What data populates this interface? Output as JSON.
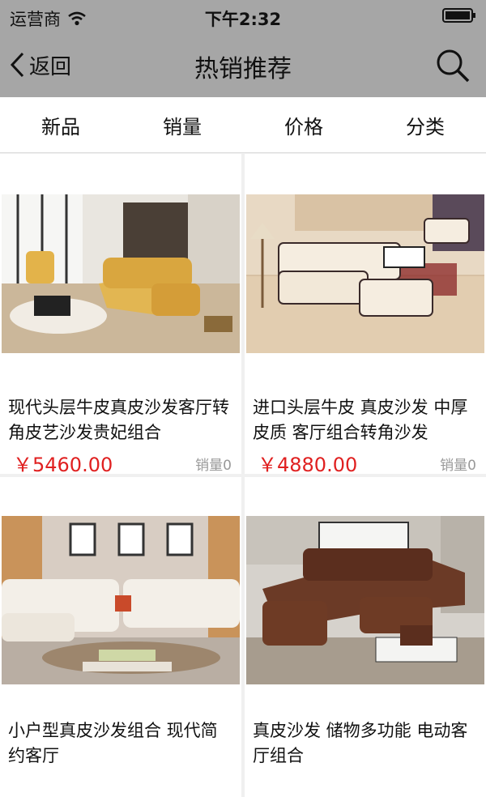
{
  "status": {
    "carrier": "运营商",
    "time": "下午2:32"
  },
  "nav": {
    "back_label": "返回",
    "title": "热销推荐"
  },
  "tabs": [
    "新品",
    "销量",
    "价格",
    "分类"
  ],
  "products": [
    {
      "title": "现代头层牛皮真皮沙发客厅转角皮艺沙发贵妃组合",
      "price": "￥5460.00",
      "sales": "销量0"
    },
    {
      "title": "进口头层牛皮 真皮沙发 中厚皮质 客厅组合转角沙发",
      "price": "￥4880.00",
      "sales": "销量0"
    },
    {
      "title": "小户型真皮沙发组合 现代简约客厅",
      "price": "",
      "sales": ""
    },
    {
      "title": "真皮沙发 储物多功能 电动客厅组合",
      "price": "",
      "sales": ""
    }
  ]
}
